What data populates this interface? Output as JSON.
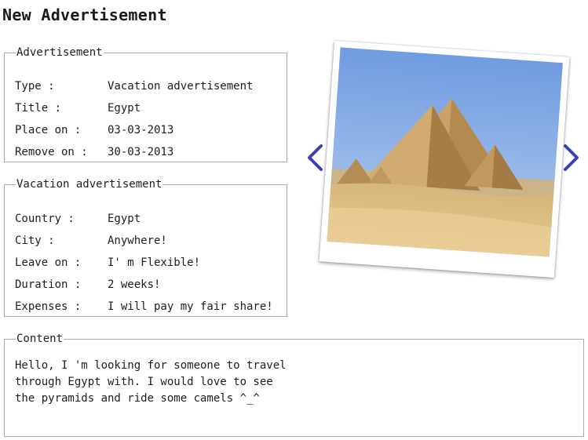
{
  "page": {
    "title": "New Advertisement"
  },
  "advertisement": {
    "legend": "Advertisement",
    "fields": [
      {
        "label": "Type :",
        "value": "Vacation advertisement"
      },
      {
        "label": "Title :",
        "value": "Egypt"
      },
      {
        "label": "Place on :",
        "value": "03-03-2013"
      },
      {
        "label": "Remove on :",
        "value": "30-03-2013"
      }
    ]
  },
  "vacation": {
    "legend": "Vacation advertisement",
    "fields": [
      {
        "label": "Country :",
        "value": "Egypt"
      },
      {
        "label": "City :",
        "value": "Anywhere!"
      },
      {
        "label": "Leave on :",
        "value": "I' m Flexible!"
      },
      {
        "label": "Duration :",
        "value": "2 weeks!"
      },
      {
        "label": "Expenses :",
        "value": "I will pay my fair share!"
      }
    ]
  },
  "content": {
    "legend": "Content",
    "text": "Hello, I 'm looking for someone to travel through Egypt with. I would love to see the pyramids and ride some camels ^_^"
  },
  "slider": {
    "prev_icon": "chevron-left-icon",
    "next_icon": "chevron-right-icon",
    "arrow_color": "#3b3fb5",
    "photo_subject": "pyramids-photo"
  }
}
